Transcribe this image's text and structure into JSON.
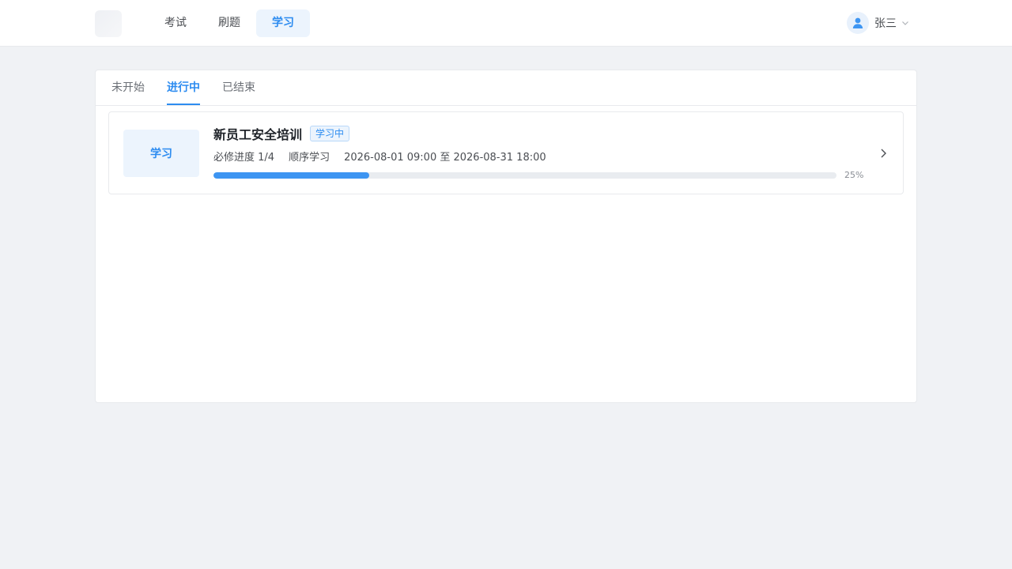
{
  "header": {
    "nav": [
      {
        "label": "考试",
        "active": false
      },
      {
        "label": "刷题",
        "active": false
      },
      {
        "label": "学习",
        "active": true
      }
    ],
    "user": {
      "name": "张三",
      "avatar_icon": "user-icon",
      "caret_icon": "chevron-down-icon"
    }
  },
  "tabs": [
    {
      "label": "未开始",
      "active": false
    },
    {
      "label": "进行中",
      "active": true
    },
    {
      "label": "已结束",
      "active": false
    }
  ],
  "course": {
    "thumb_label": "学习",
    "title": "新员工安全培训",
    "badge": "学习中",
    "required_progress": "必修进度 1/4",
    "mode": "顺序学习",
    "period": "2026-08-01 09:00 至 2026-08-31 18:00",
    "progress_percent": 25,
    "progress_text": "25%",
    "arrow_icon": "chevron-right-icon"
  },
  "colors": {
    "accent": "#2d8cf0",
    "background": "#f0f2f5"
  }
}
